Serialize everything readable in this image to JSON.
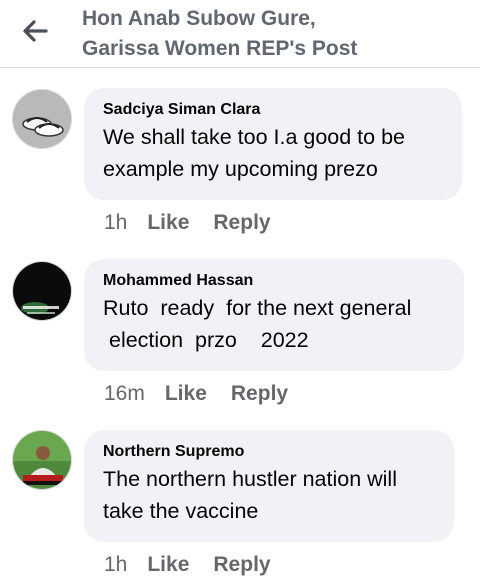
{
  "header": {
    "title_line1": "Hon Anab Subow Gure,",
    "title_line2": "Garissa Women REP's Post"
  },
  "comments": [
    {
      "author": "Sadciya Siman Clara",
      "text": "We shall take too I.a good to be\nexample my upcoming prezo",
      "time": "1h",
      "like": "Like",
      "reply": "Reply"
    },
    {
      "author": "Mohammed Hassan",
      "text": "Ruto  ready  for the next general\n election  przo    2022",
      "time": "16m",
      "like": "Like",
      "reply": "Reply"
    },
    {
      "author": "Northern Supremo",
      "text": "The northern hustler nation will\ntake the vaccine",
      "time": "1h",
      "like": "Like",
      "reply": "Reply"
    }
  ],
  "colors": {
    "bubble": "#f0f2f5",
    "meta": "#65676b",
    "header_text": "#606770"
  }
}
